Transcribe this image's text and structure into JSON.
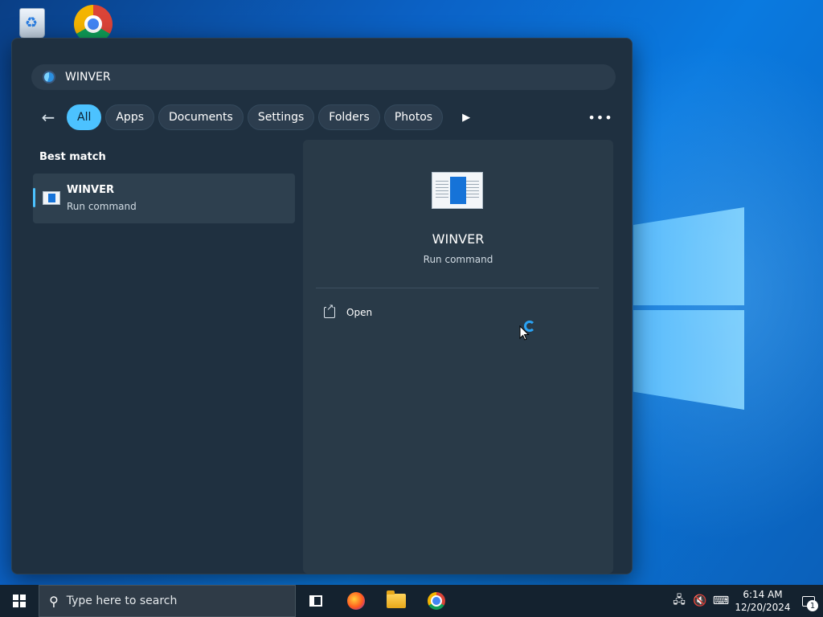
{
  "search": {
    "query": "WINVER"
  },
  "filters": [
    {
      "label": "All",
      "active": true
    },
    {
      "label": "Apps"
    },
    {
      "label": "Documents"
    },
    {
      "label": "Settings"
    },
    {
      "label": "Folders"
    },
    {
      "label": "Photos"
    }
  ],
  "best_match": {
    "heading": "Best match",
    "name": "WINVER",
    "type": "Run command"
  },
  "detail": {
    "name": "WINVER",
    "type": "Run command",
    "actions": [
      {
        "label": "Open",
        "icon": "open-external-icon"
      }
    ]
  },
  "taskbar": {
    "search_placeholder": "Type here to search",
    "apps": [
      "task-view-icon",
      "firefox-icon",
      "file-explorer-icon",
      "chrome-icon"
    ],
    "time": "6:14 AM",
    "date": "12/20/2024",
    "notification_count": "1"
  },
  "colors": {
    "accent": "#4cc2ff",
    "flyout_bg": "#1f3040",
    "taskbar_bg": "#14222f"
  }
}
